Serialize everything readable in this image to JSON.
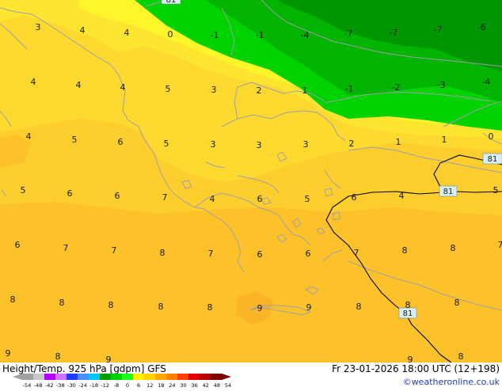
{
  "footer": {
    "left_title": "Height/Temp. 925 hPa [gdpm] GFS",
    "datetime": "Fr 23-01-2026 18:00 UTC (12+198)",
    "credit": "©weatheronline.co.uk"
  },
  "legend": {
    "tick_labels": [
      "-54",
      "-48",
      "-42",
      "-38",
      "-30",
      "-24",
      "-18",
      "-12",
      "-8",
      "0",
      "6",
      "12",
      "18",
      "24",
      "30",
      "36",
      "42",
      "48",
      "54"
    ],
    "colors": [
      "#a0a0a0",
      "#c8c8c8",
      "#b400ff",
      "#d070ff",
      "#1e3cff",
      "#4c8cff",
      "#00c8ff",
      "#00a000",
      "#00d200",
      "#19ff19",
      "#fff000",
      "#ffd200",
      "#ffa800",
      "#ff8000",
      "#ff4000",
      "#e60000",
      "#b40000",
      "#800000"
    ]
  },
  "map": {
    "temperature_labels": [
      {
        "id": "t1",
        "text": "3"
      },
      {
        "id": "t2",
        "text": "4"
      },
      {
        "id": "t3",
        "text": "4"
      },
      {
        "id": "t4",
        "text": "0"
      },
      {
        "id": "t5",
        "text": "-1"
      },
      {
        "id": "t6",
        "text": "-1"
      },
      {
        "id": "t7",
        "text": "-4"
      },
      {
        "id": "t8",
        "text": "-7"
      },
      {
        "id": "t9",
        "text": "-7"
      },
      {
        "id": "t10",
        "text": "-7"
      },
      {
        "id": "t11",
        "text": "-6"
      },
      {
        "id": "t12",
        "text": "4"
      },
      {
        "id": "t13",
        "text": "4"
      },
      {
        "id": "t14",
        "text": "4"
      },
      {
        "id": "t15",
        "text": "5"
      },
      {
        "id": "t16",
        "text": "3"
      },
      {
        "id": "t17",
        "text": "2"
      },
      {
        "id": "t18",
        "text": "1"
      },
      {
        "id": "t19",
        "text": "-1"
      },
      {
        "id": "t20",
        "text": "-2"
      },
      {
        "id": "t21",
        "text": "-3"
      },
      {
        "id": "t22",
        "text": "-4"
      },
      {
        "id": "t23",
        "text": "4"
      },
      {
        "id": "t24",
        "text": "5"
      },
      {
        "id": "t25",
        "text": "6"
      },
      {
        "id": "t26",
        "text": "5"
      },
      {
        "id": "t27",
        "text": "3"
      },
      {
        "id": "t28",
        "text": "3"
      },
      {
        "id": "t29",
        "text": "3"
      },
      {
        "id": "t30",
        "text": "2"
      },
      {
        "id": "t31",
        "text": "1"
      },
      {
        "id": "t32",
        "text": "1"
      },
      {
        "id": "t33",
        "text": "0"
      },
      {
        "id": "t34",
        "text": "5"
      },
      {
        "id": "t35",
        "text": "6"
      },
      {
        "id": "t36",
        "text": "6"
      },
      {
        "id": "t37",
        "text": "7"
      },
      {
        "id": "t38",
        "text": "4"
      },
      {
        "id": "t39",
        "text": "6"
      },
      {
        "id": "t40",
        "text": "5"
      },
      {
        "id": "t41",
        "text": "6"
      },
      {
        "id": "t42",
        "text": "4"
      },
      {
        "id": "t43",
        "text": "5"
      },
      {
        "id": "t44",
        "text": "6"
      },
      {
        "id": "t45",
        "text": "7"
      },
      {
        "id": "t46",
        "text": "7"
      },
      {
        "id": "t47",
        "text": "8"
      },
      {
        "id": "t48",
        "text": "7"
      },
      {
        "id": "t49",
        "text": "6"
      },
      {
        "id": "t50",
        "text": "6"
      },
      {
        "id": "t51",
        "text": "7"
      },
      {
        "id": "t52",
        "text": "8"
      },
      {
        "id": "t53",
        "text": "8"
      },
      {
        "id": "t54",
        "text": "7"
      },
      {
        "id": "t55",
        "text": "8"
      },
      {
        "id": "t56",
        "text": "8"
      },
      {
        "id": "t57",
        "text": "8"
      },
      {
        "id": "t58",
        "text": "8"
      },
      {
        "id": "t59",
        "text": "8"
      },
      {
        "id": "t60",
        "text": "9"
      },
      {
        "id": "t61",
        "text": "9"
      },
      {
        "id": "t62",
        "text": "8"
      },
      {
        "id": "t63",
        "text": "8"
      },
      {
        "id": "t64",
        "text": "8"
      },
      {
        "id": "t65",
        "text": "9"
      },
      {
        "id": "t66",
        "text": "8"
      },
      {
        "id": "t67",
        "text": "9"
      },
      {
        "id": "t68",
        "text": "9"
      },
      {
        "id": "t69",
        "text": "8"
      }
    ],
    "contour_labels": [
      {
        "id": "c1",
        "text": "81"
      },
      {
        "id": "c2",
        "text": "81"
      },
      {
        "id": "c3",
        "text": "81"
      },
      {
        "id": "c4",
        "text": "81"
      }
    ]
  }
}
